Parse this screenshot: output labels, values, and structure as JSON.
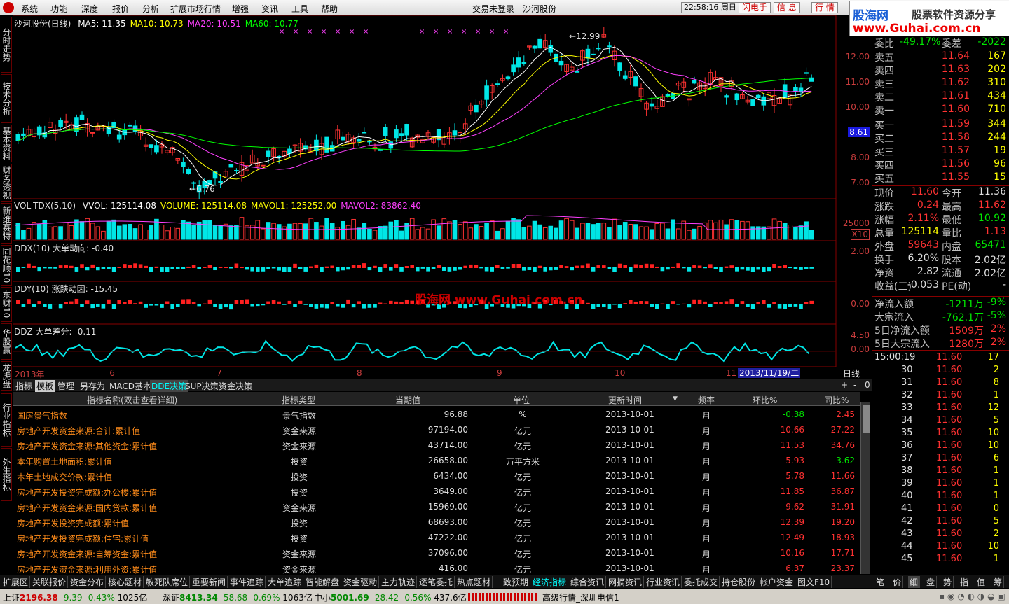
{
  "menu": {
    "items": [
      "系统",
      "功能",
      "深度",
      "报价",
      "分析",
      "扩展市场行情",
      "增强",
      "资讯",
      "工具",
      "帮助"
    ],
    "center1": "交易未登录",
    "center2": "沙河股份",
    "time": "22:58:16 周日",
    "btn1": "闪电手",
    "btn2": "信 息",
    "btn3": "行 情"
  },
  "brand": {
    "a": "股海网",
    "b": "股票软件资源分享",
    "c": "www.Guhai.com.cn"
  },
  "left_tabs": [
    "分时走势",
    "技术分析",
    "基本资料",
    "财务透视",
    "新维赛特",
    "同花顺10",
    "东财10",
    "华股赢家",
    "龙虎盘",
    "行业指标",
    "外生指标"
  ],
  "chart": {
    "title": "沙河股份(日线)",
    "ma": [
      {
        "label": "MA5: 11.35",
        "color": "#ffffff"
      },
      {
        "label": "MA10: 10.73",
        "color": "#ffff00"
      },
      {
        "label": "MA20: 10.51",
        "color": "#ff40ff"
      },
      {
        "label": "MA60: 10.77",
        "color": "#00ff00"
      }
    ],
    "high_label": "12.99",
    "low_label": "6.76",
    "cur_price_tag": "8.61",
    "price_ticks": [
      "12.00",
      "11.00",
      "10.00",
      "9.00",
      "8.00",
      "7.00"
    ],
    "vol_label": "VOL-TDX(5,10)",
    "vol_items": [
      {
        "t": "VVOL: 125114.08",
        "c": "#ffffff"
      },
      {
        "t": "VOLUME: 125114.08",
        "c": "#ffff00"
      },
      {
        "t": "MAVOL1: 125252.00",
        "c": "#ffff00"
      },
      {
        "t": "MAVOL2: 83862.40",
        "c": "#ff40ff"
      }
    ],
    "vol_tick": "25000",
    "vol_unit": "X10",
    "ddx": "DDX(10)",
    "ddx_sub": "大单动向: -0.40",
    "ddx_tick": "2.00",
    "ddy": "DDY(10)",
    "ddy_sub": "涨跌动因: -15.45",
    "ddy_tick": "0.00",
    "ddz": "DDZ",
    "ddz_sub": "大单差分: -0.11",
    "ddz_ticks": [
      "4.50",
      "0.00"
    ],
    "watermark": "股海网 www.Guhai.com.cn",
    "xaxis": [
      {
        "t": "2013年",
        "f": 0.0
      },
      {
        "t": "6",
        "f": 0.115
      },
      {
        "t": "7",
        "f": 0.245
      },
      {
        "t": "8",
        "f": 0.415
      },
      {
        "t": "9",
        "f": 0.585
      },
      {
        "t": "10",
        "f": 0.728
      },
      {
        "t": "11",
        "f": 0.863
      }
    ],
    "date_box": "2013/11/19/二",
    "period": "日线"
  },
  "quote": {
    "wb": {
      "l": "委比",
      "v": "-49.17%",
      "l2": "委差",
      "v2": "-2022"
    },
    "asks": [
      {
        "l": "卖五",
        "p": "11.64",
        "q": "167"
      },
      {
        "l": "卖四",
        "p": "11.63",
        "q": "202"
      },
      {
        "l": "卖三",
        "p": "11.62",
        "q": "310"
      },
      {
        "l": "卖二",
        "p": "11.61",
        "q": "434"
      },
      {
        "l": "卖一",
        "p": "11.60",
        "q": "710"
      }
    ],
    "bids": [
      {
        "l": "买一",
        "p": "11.59",
        "q": "344"
      },
      {
        "l": "买二",
        "p": "11.58",
        "q": "244"
      },
      {
        "l": "买三",
        "p": "11.57",
        "q": "19"
      },
      {
        "l": "买四",
        "p": "11.56",
        "q": "96"
      },
      {
        "l": "买五",
        "p": "11.55",
        "q": "15"
      }
    ],
    "stats": [
      {
        "l": "现价",
        "v": "11.60",
        "c": "red",
        "l2": "今开",
        "v2": "11.36",
        "c2": "wht"
      },
      {
        "l": "涨跌",
        "v": "0.24",
        "c": "red",
        "l2": "最高",
        "v2": "11.62",
        "c2": "red"
      },
      {
        "l": "涨幅",
        "v": "2.11%",
        "c": "red",
        "l2": "最低",
        "v2": "10.92",
        "c2": "green"
      },
      {
        "l": "总量",
        "v": "125114",
        "c": "yel",
        "l2": "量比",
        "v2": "1.13",
        "c2": "red"
      },
      {
        "l": "外盘",
        "v": "59643",
        "c": "red",
        "l2": "内盘",
        "v2": "65471",
        "c2": "green"
      },
      {
        "l": "换手",
        "v": "6.20%",
        "c": "wht",
        "l2": "股本",
        "v2": "2.02亿",
        "c2": "wht"
      },
      {
        "l": "净资",
        "v": "2.82",
        "c": "wht",
        "l2": "流通",
        "v2": "2.02亿",
        "c2": "wht"
      },
      {
        "l": "收益(三)",
        "v": "-0.053",
        "c": "wht",
        "l2": "PE(动)",
        "v2": "-",
        "c2": "wht"
      }
    ],
    "flows": [
      {
        "l": "净流入额",
        "v": "-1211万",
        "c": "green",
        "p": "-9%",
        "pc": "green"
      },
      {
        "l": "大宗流入",
        "v": "-762.1万",
        "c": "green",
        "p": "-5%",
        "pc": "green"
      },
      {
        "l": "5日净流入额",
        "v": "1509万",
        "c": "red",
        "p": "2%",
        "pc": "red"
      },
      {
        "l": "5日大宗流入",
        "v": "1280万",
        "c": "red",
        "p": "2%",
        "pc": "red"
      }
    ]
  },
  "ticks": [
    {
      "t": "15:00:19",
      "p": "11.60",
      "v": "17"
    },
    {
      "t": "30",
      "p": "11.60",
      "v": "2"
    },
    {
      "t": "31",
      "p": "11.60",
      "v": "8"
    },
    {
      "t": "32",
      "p": "11.60",
      "v": "1"
    },
    {
      "t": "33",
      "p": "11.60",
      "v": "12"
    },
    {
      "t": "34",
      "p": "11.60",
      "v": "5"
    },
    {
      "t": "35",
      "p": "11.60",
      "v": "10"
    },
    {
      "t": "36",
      "p": "11.60",
      "v": "10"
    },
    {
      "t": "37",
      "p": "11.60",
      "v": "6"
    },
    {
      "t": "38",
      "p": "11.60",
      "v": "1"
    },
    {
      "t": "39",
      "p": "11.60",
      "v": "1"
    },
    {
      "t": "40",
      "p": "11.60",
      "v": "1"
    },
    {
      "t": "41",
      "p": "11.60",
      "v": "0"
    },
    {
      "t": "42",
      "p": "11.60",
      "v": "5"
    },
    {
      "t": "43",
      "p": "11.60",
      "v": "2"
    },
    {
      "t": "44",
      "p": "11.60",
      "v": "10"
    },
    {
      "t": "45",
      "p": "11.60",
      "v": "1"
    }
  ],
  "tabs2": [
    "指标",
    "模板",
    "管理",
    "另存为",
    "MACD基本",
    "DDE决策",
    "SUP决策",
    "资金决策"
  ],
  "tabs2_right": [
    "+",
    "-",
    "0"
  ],
  "table": {
    "headers": [
      "指标名称(双击查看详细)",
      "指标类型",
      "当期值",
      "单位",
      "更新时间",
      "频率",
      "环比%",
      "同比%"
    ],
    "rows": [
      {
        "n": "国房景气指数",
        "t": "景气指数",
        "v": "96.88",
        "u": "%",
        "d": "2013-10-01",
        "f": "月",
        "h": "-0.38",
        "hc": "green",
        "y": "2.45",
        "yc": "red"
      },
      {
        "n": "房地产开发资金来源:合计:累计值",
        "t": "资金来源",
        "v": "97194.00",
        "u": "亿元",
        "d": "2013-10-01",
        "f": "月",
        "h": "10.66",
        "hc": "red",
        "y": "27.22",
        "yc": "red"
      },
      {
        "n": "房地产开发资金来源:其他资金:累计值",
        "t": "资金来源",
        "v": "43714.00",
        "u": "亿元",
        "d": "2013-10-01",
        "f": "月",
        "h": "11.53",
        "hc": "red",
        "y": "34.76",
        "yc": "red"
      },
      {
        "n": "本年购置土地面积:累计值",
        "t": "投资",
        "v": "26658.00",
        "u": "万平方米",
        "d": "2013-10-01",
        "f": "月",
        "h": "5.93",
        "hc": "red",
        "y": "-3.62",
        "yc": "green"
      },
      {
        "n": "本年土地成交价款:累计值",
        "t": "投资",
        "v": "6434.00",
        "u": "亿元",
        "d": "2013-10-01",
        "f": "月",
        "h": "5.78",
        "hc": "red",
        "y": "11.66",
        "yc": "red"
      },
      {
        "n": "房地产开发投资完成额:办公楼:累计值",
        "t": "投资",
        "v": "3649.00",
        "u": "亿元",
        "d": "2013-10-01",
        "f": "月",
        "h": "11.85",
        "hc": "red",
        "y": "36.87",
        "yc": "red"
      },
      {
        "n": "房地产开发资金来源:国内贷款:累计值",
        "t": "资金来源",
        "v": "15969.00",
        "u": "亿元",
        "d": "2013-10-01",
        "f": "月",
        "h": "9.62",
        "hc": "red",
        "y": "31.91",
        "yc": "red"
      },
      {
        "n": "房地产开发投资完成额:累计值",
        "t": "投资",
        "v": "68693.00",
        "u": "亿元",
        "d": "2013-10-01",
        "f": "月",
        "h": "12.39",
        "hc": "red",
        "y": "19.20",
        "yc": "red"
      },
      {
        "n": "房地产开发投资完成额:住宅:累计值",
        "t": "投资",
        "v": "47222.00",
        "u": "亿元",
        "d": "2013-10-01",
        "f": "月",
        "h": "12.49",
        "hc": "red",
        "y": "18.93",
        "yc": "red"
      },
      {
        "n": "房地产开发资金来源:自筹资金:累计值",
        "t": "资金来源",
        "v": "37096.00",
        "u": "亿元",
        "d": "2013-10-01",
        "f": "月",
        "h": "10.16",
        "hc": "red",
        "y": "17.71",
        "yc": "red"
      },
      {
        "n": "房地产开发资金来源:利用外资:累计值",
        "t": "资金来源",
        "v": "416.00",
        "u": "亿元",
        "d": "2013-10-01",
        "f": "月",
        "h": "6.37",
        "hc": "red",
        "y": "23.37",
        "yc": "red"
      }
    ]
  },
  "bottom_tabs": [
    "扩展区",
    "关联报价",
    "资金分布",
    "核心题材",
    "敏死队席位",
    "重要新闻",
    "事件追踪",
    "大单追踪",
    "智能解盘",
    "资金驱动",
    "主力轨迹",
    "逐笔委托",
    "热点题材",
    "一致预期",
    "经济指标",
    "综合资讯",
    "网摘资讯",
    "行业资讯",
    "委托成交",
    "持仓股份",
    "帐户资金",
    "图文F10"
  ],
  "bottom_right": [
    "笔",
    "价",
    "细",
    "盘",
    "势",
    "指",
    "值",
    "筹"
  ],
  "status": {
    "sh": {
      "l": "上证",
      "v": "2196.38",
      "c": "-9.39",
      "p": "-0.43%",
      "a": "1025亿"
    },
    "sz": {
      "l": "深证",
      "v": "8413.34",
      "c": "-58.68",
      "p": "-0.69%",
      "a": "1063亿"
    },
    "zx": {
      "l": "中小",
      "v": "5001.69",
      "c": "-28.42",
      "p": "-0.56%",
      "a": "437.6亿"
    },
    "server": "高级行情_深圳电信1"
  }
}
